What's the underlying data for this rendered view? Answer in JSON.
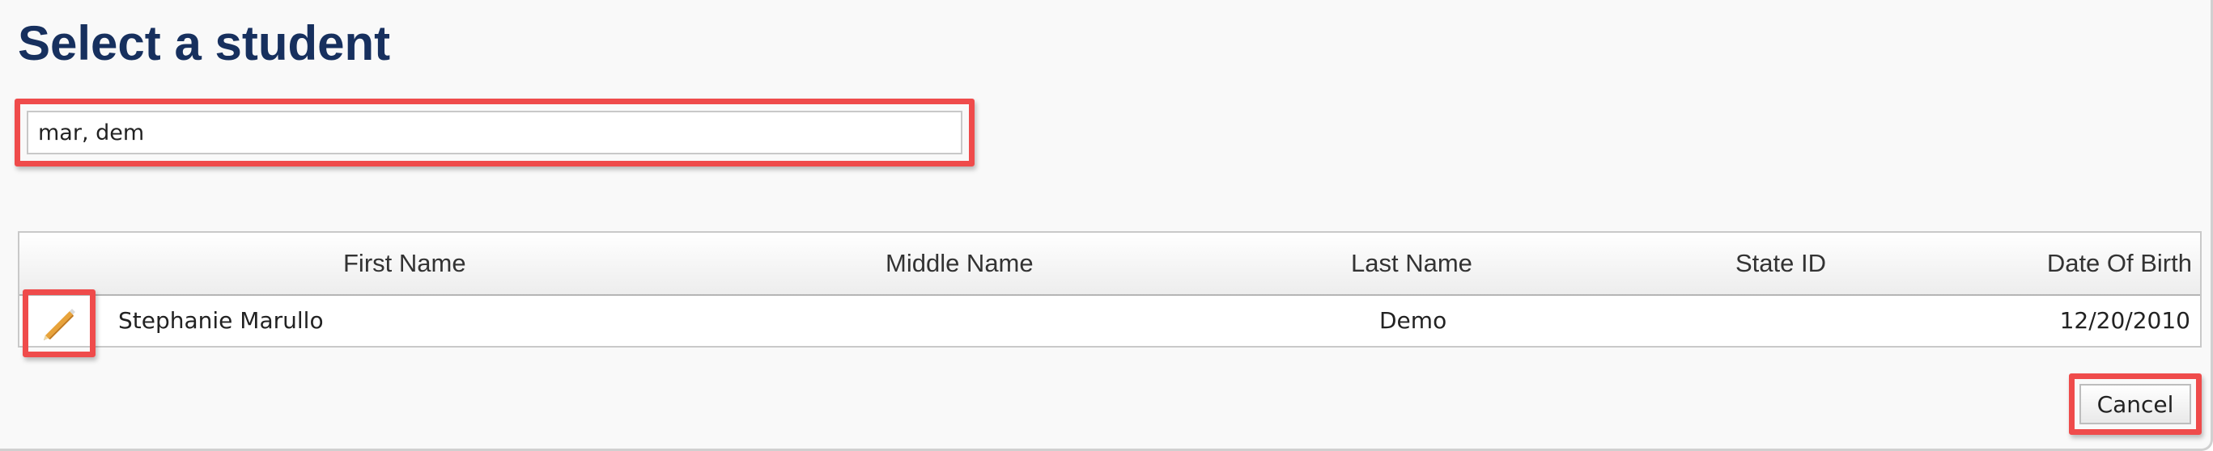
{
  "dialog": {
    "title": "Select a student"
  },
  "search": {
    "value": "mar, dem"
  },
  "table": {
    "columns": [
      "First Name",
      "Middle Name",
      "Last Name",
      "State ID",
      "Date Of Birth"
    ],
    "rows": [
      {
        "first_name": "Stephanie Marullo",
        "middle_name": "",
        "last_name": "Demo",
        "state_id": "",
        "date_of_birth": "12/20/2010",
        "action_icon": "pencil-icon"
      }
    ]
  },
  "actions": {
    "cancel_label": "Cancel"
  },
  "colors": {
    "title": "#17305e",
    "highlight": "#ef4b4b"
  }
}
